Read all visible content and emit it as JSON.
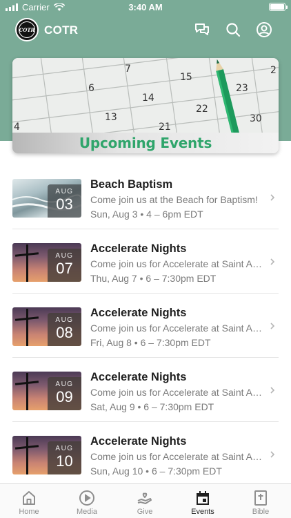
{
  "status_bar": {
    "carrier": "Carrier",
    "time": "3:40 AM"
  },
  "header": {
    "app_name": "COTR",
    "logo_text": "COTR"
  },
  "banner": {
    "title": "Upcoming Events",
    "calendar_numbers": [
      "7",
      "15",
      "6",
      "14",
      "22",
      "4",
      "13",
      "21",
      "23",
      "30",
      "2"
    ]
  },
  "events": [
    {
      "month": "AUG",
      "day": "03",
      "title": "Beach Baptism",
      "description": "Come join us at the Beach for Baptism!",
      "time": "Sun, Aug 3 • 4 – 6pm EDT",
      "image": "beach"
    },
    {
      "month": "AUG",
      "day": "07",
      "title": "Accelerate Nights",
      "description": "Come join us for Accelerate at Saint Augustine Beach!",
      "time": "Thu, Aug 7 • 6 – 7:30pm EDT",
      "image": "cross"
    },
    {
      "month": "AUG",
      "day": "08",
      "title": "Accelerate Nights",
      "description": "Come join us for Accelerate at Saint Augustine Beach!",
      "time": "Fri, Aug 8 • 6 – 7:30pm EDT",
      "image": "cross"
    },
    {
      "month": "AUG",
      "day": "09",
      "title": "Accelerate Nights",
      "description": "Come join us for Accelerate at Saint Augustine Beach!",
      "time": "Sat, Aug 9 • 6 – 7:30pm EDT",
      "image": "cross"
    },
    {
      "month": "AUG",
      "day": "10",
      "title": "Accelerate Nights",
      "description": "Come join us for Accelerate at Saint Augustine Beach!",
      "time": "Sun, Aug 10 • 6 – 7:30pm EDT",
      "image": "cross"
    }
  ],
  "tabs": [
    {
      "label": "Home",
      "icon": "home-icon",
      "active": false
    },
    {
      "label": "Media",
      "icon": "play-icon",
      "active": false
    },
    {
      "label": "Give",
      "icon": "give-icon",
      "active": false
    },
    {
      "label": "Events",
      "icon": "calendar-icon",
      "active": true
    },
    {
      "label": "Bible",
      "icon": "bible-icon",
      "active": false
    }
  ],
  "colors": {
    "header": "#7aab97",
    "accent_green": "#2fa56b"
  }
}
